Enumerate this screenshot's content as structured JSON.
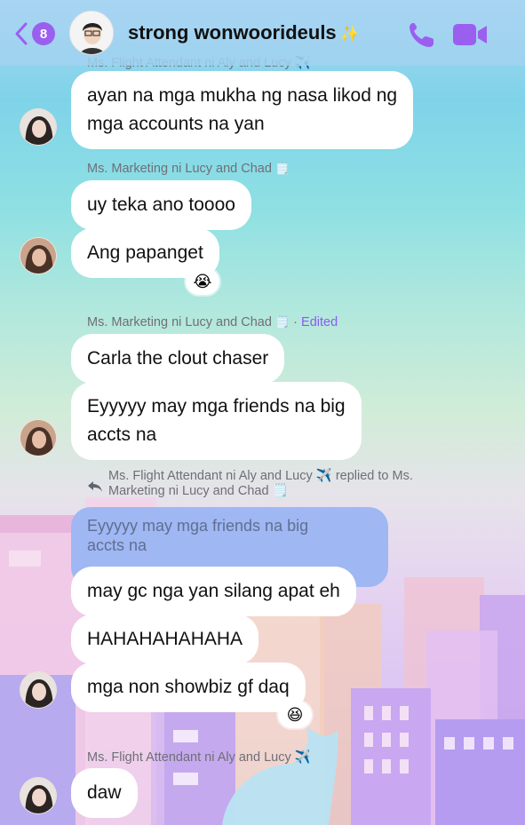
{
  "header": {
    "back_count": "8",
    "title": "strong wonwoorideuls",
    "title_emoji": "✨"
  },
  "messages": {
    "top_sender_cut": "Ms. Flight Attendant ni Aly and Lucy ✈️",
    "m1": "ayan na mga mukha ng nasa likod ng",
    "m1b": "mga accounts na yan",
    "sender2": "Ms. Marketing ni Lucy and Chad",
    "sender2_emoji": "🗒️",
    "m2": "uy teka ano toooo",
    "m3": "Ang papanget",
    "m3_reaction": "😭",
    "sender3": "Ms. Marketing ni Lucy and Chad",
    "sender3_emoji": "🗒️",
    "sender3_sep": " · ",
    "sender3_edited": "Edited",
    "m4": "Carla the clout chaser",
    "m5": "Eyyyyy may mga friends na big",
    "m5b": "accts na",
    "reply_meta_line1": "Ms. Flight Attendant ni Aly and Lucy ✈️ replied to Ms.",
    "reply_meta_line2": "Marketing ni Lucy and Chad 🗒️",
    "quoted_1": "Eyyyyy may mga friends na big",
    "quoted_2": "accts na",
    "m6": "may gc nga yan silang apat eh",
    "m7": "HAHAHAHAHAHA",
    "m8": "mga non showbiz gf daq",
    "m8_reaction": "😆",
    "sender4": "Ms. Flight Attendant ni Aly and Lucy ✈️",
    "m9": "daw"
  },
  "colors": {
    "accent": "#9b5ff0",
    "bubble": "#ffffff",
    "reply_bubble": "#9fb7f3"
  },
  "icons": {
    "back": "chevron-left-icon",
    "phone": "phone-icon",
    "video": "video-camera-icon",
    "reply": "reply-arrow-icon"
  }
}
